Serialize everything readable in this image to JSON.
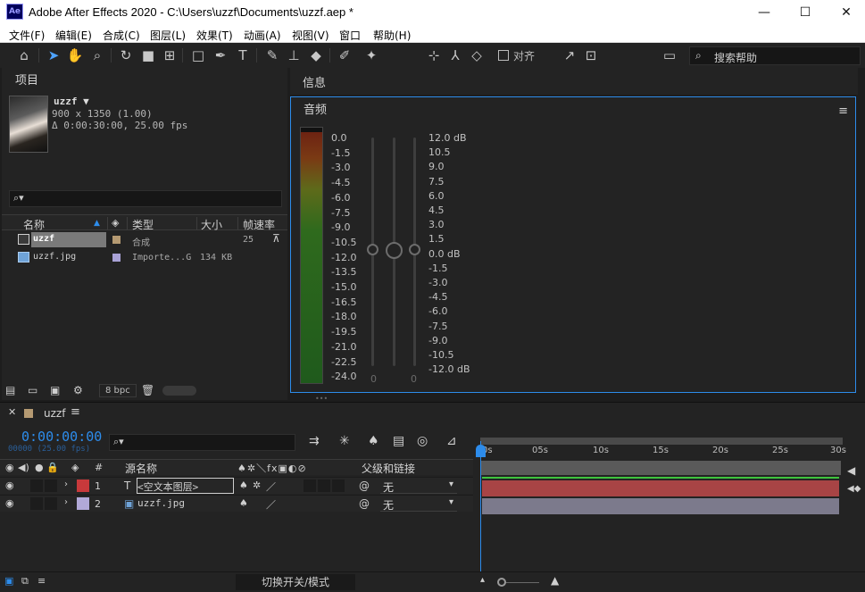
{
  "window": {
    "title": "Adobe After Effects 2020 - C:\\Users\\uzzf\\Documents\\uzzf.aep *",
    "logo": "Ae",
    "controls": {
      "minimize": "—",
      "maximize": "☐",
      "close": "✕"
    }
  },
  "menu": [
    "文件(F)",
    "编辑(E)",
    "合成(C)",
    "图层(L)",
    "效果(T)",
    "动画(A)",
    "视图(V)",
    "窗口",
    "帮助(H)"
  ],
  "toolbar": {
    "align_label": "对齐",
    "search_placeholder": "搜索帮助"
  },
  "project": {
    "title": "项目",
    "comp_name": "uzzf ▼",
    "comp_size": "900 x 1350 (1.00)",
    "comp_duration": "Δ 0:00:30:00, 25.00 fps",
    "search_icon": "⌕▾",
    "columns": {
      "name": "名称",
      "type": "类型",
      "size": "大小",
      "fps": "帧速率"
    },
    "items": [
      {
        "name": "uzzf",
        "type": "合成",
        "size": "",
        "fps": "25",
        "color": "#b59a72"
      },
      {
        "name": "uzzf.jpg",
        "type": "Importe...G",
        "size": "134 KB",
        "fps": "",
        "color": "#a9a2d6"
      }
    ],
    "bpc": "8 bpc"
  },
  "info": {
    "title": "信息"
  },
  "audio": {
    "title": "音频",
    "left_scale": [
      "0.0",
      "-1.5",
      "-3.0",
      "-4.5",
      "-6.0",
      "-7.5",
      "-9.0",
      "-10.5",
      "-12.0",
      "-13.5",
      "-15.0",
      "-16.5",
      "-18.0",
      "-19.5",
      "-21.0",
      "-22.5",
      "-24.0"
    ],
    "right_scale": [
      "12.0 dB",
      "10.5",
      "9.0",
      "7.5",
      "6.0",
      "4.5",
      "3.0",
      "1.5",
      "0.0 dB",
      "-1.5",
      "-3.0",
      "-4.5",
      "-6.0",
      "-7.5",
      "-9.0",
      "-10.5",
      "-12.0 dB"
    ],
    "left_value": "0",
    "right_value": "0"
  },
  "timeline": {
    "comp_tab": "uzzf",
    "timecode": "0:00:00:00",
    "framecode": "00000 (25.00 fps)",
    "columns": {
      "source_name": "源名称",
      "parent": "父级和链接"
    },
    "ruler": [
      "0s",
      "05s",
      "10s",
      "15s",
      "20s",
      "25s",
      "30s"
    ],
    "layers": [
      {
        "num": "1",
        "name": "<空文本图层>",
        "parent": "无",
        "label_color": "#c8393b",
        "bar_color": "#a84445",
        "type_glyph": "T"
      },
      {
        "num": "2",
        "name": "uzzf.jpg",
        "parent": "无",
        "label_color": "#b2a9d8",
        "bar_color": "#7c7a8c",
        "type_glyph": "▣"
      }
    ],
    "footer_label": "切换开关/模式"
  }
}
